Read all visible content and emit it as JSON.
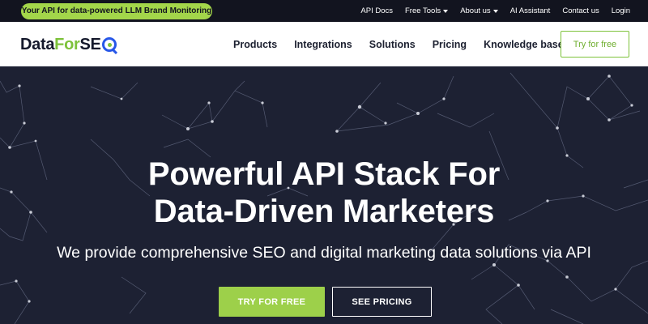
{
  "topbar": {
    "promo": "Your API for data-powered LLM Brand Monitoring >>",
    "links": [
      {
        "label": "API Docs"
      },
      {
        "label": "Free Tools"
      },
      {
        "label": "About us"
      },
      {
        "label": "AI Assistant"
      },
      {
        "label": "Contact us"
      },
      {
        "label": "Login"
      }
    ]
  },
  "header": {
    "logo": {
      "part1": "Data",
      "part2": "For",
      "part3": "SE"
    },
    "nav": [
      "Products",
      "Integrations",
      "Solutions",
      "Pricing",
      "Knowledge base"
    ],
    "cta": "Try for free"
  },
  "hero": {
    "title_line1": "Powerful API Stack For",
    "title_line2": "Data-Driven Marketers",
    "subtitle": "We provide comprehensive SEO and digital marketing data solutions via API",
    "primary_button": "TRY FOR FREE",
    "secondary_button": "SEE PRICING"
  },
  "colors": {
    "topbar_bg": "#12141f",
    "accent_green": "#9dd04a",
    "hero_bg": "#1d2133",
    "logo_blue": "#2757e8"
  }
}
